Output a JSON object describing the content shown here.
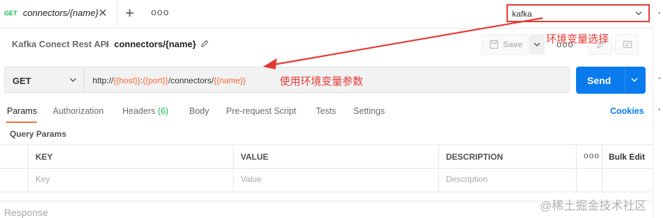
{
  "tab": {
    "method": "GET",
    "title": "connectors/{name}",
    "close_icon": "close-icon"
  },
  "tabstrip": {
    "new_tab_icon": "plus-icon",
    "more_icon": "more-dots-icon"
  },
  "environment": {
    "selected": "kafka"
  },
  "breadcrumb": {
    "collection": "Kafka Conect Rest API",
    "separator": "/",
    "request": "connectors/{name}"
  },
  "toolbar": {
    "save_label": "Save",
    "more_label": "ooo"
  },
  "annotations": {
    "env_select": "环境变量选择",
    "use_env_vars": "使用环境变量参数"
  },
  "request": {
    "method": "GET",
    "url_parts": [
      {
        "text": "http://",
        "var": false
      },
      {
        "text": "{{host}}",
        "var": true
      },
      {
        "text": ":",
        "var": false
      },
      {
        "text": "{{port}}",
        "var": true
      },
      {
        "text": "/connectors/",
        "var": false
      },
      {
        "text": "{{name}}",
        "var": true
      }
    ],
    "send_label": "Send"
  },
  "subtabs": {
    "params": "Params",
    "authorization": "Authorization",
    "headers": "Headers",
    "headers_count": "(6)",
    "body": "Body",
    "prerequest": "Pre-request Script",
    "tests": "Tests",
    "settings": "Settings",
    "cookies": "Cookies"
  },
  "query_params": {
    "title": "Query Params",
    "columns": {
      "key": "KEY",
      "value": "VALUE",
      "description": "DESCRIPTION",
      "more": "ooo",
      "bulk_edit": "Bulk Edit"
    },
    "placeholders": {
      "key": "Key",
      "value": "Value",
      "description": "Description"
    }
  },
  "response": {
    "label": "Response"
  },
  "watermark": "@稀土掘金技术社区",
  "colors": {
    "accent": "#097bed",
    "variable": "#f26b3a",
    "annotation": "#e53935",
    "get_method": "#0cbb52"
  }
}
